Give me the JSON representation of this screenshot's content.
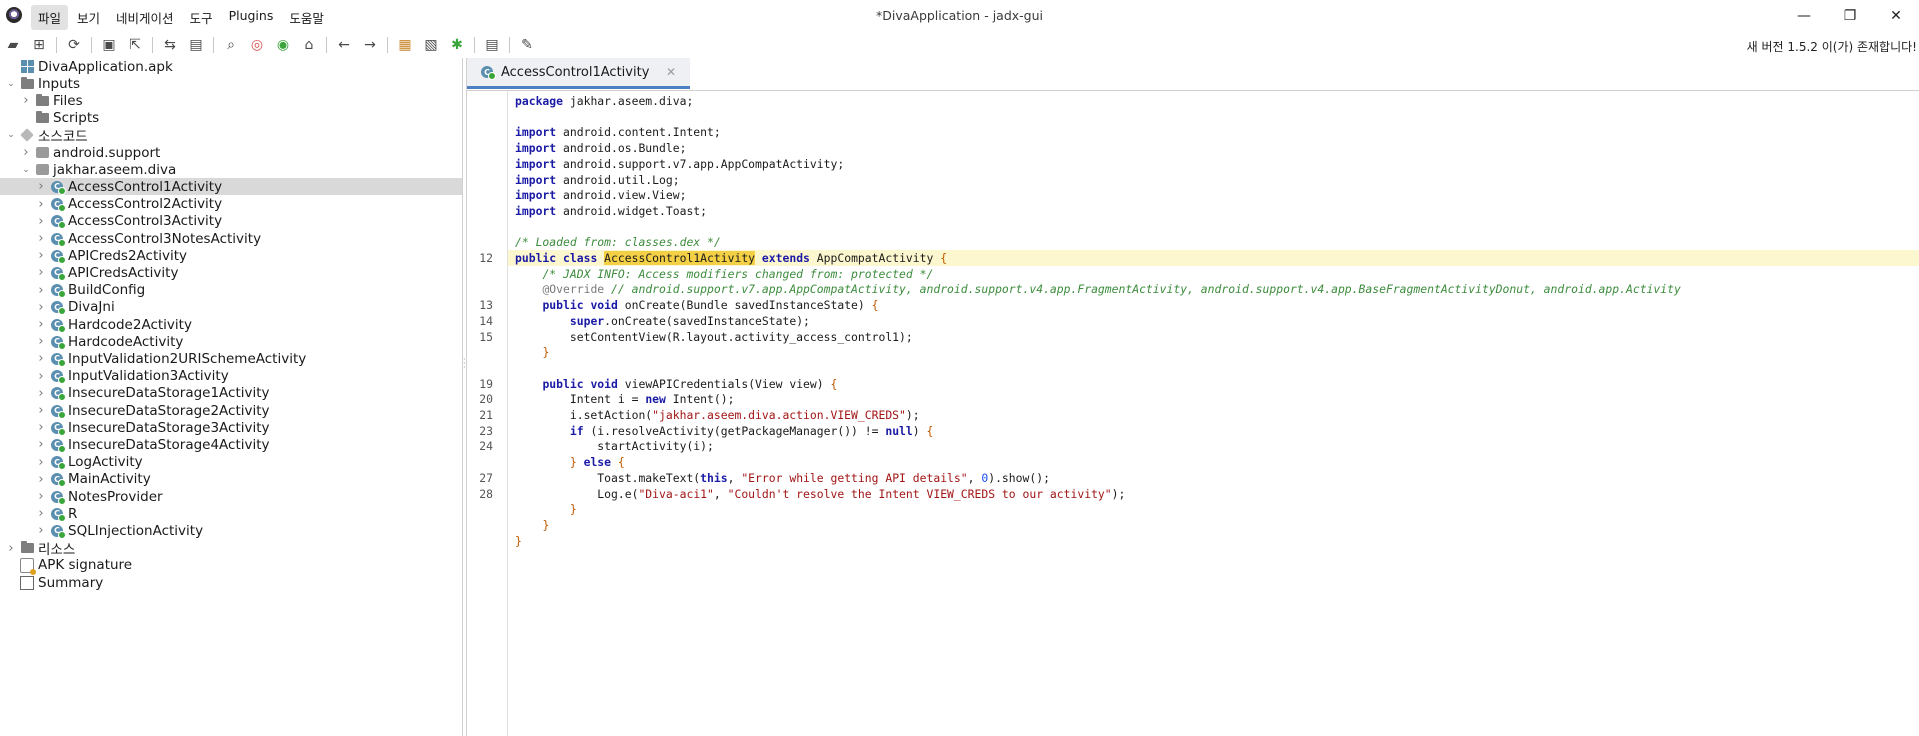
{
  "window": {
    "title": "*DivaApplication - jadx-gui",
    "minimize": "—",
    "maximize": "❐",
    "close": "✕"
  },
  "menu": [
    {
      "label": "파일",
      "active": true
    },
    {
      "label": "보기"
    },
    {
      "label": "네비게이션"
    },
    {
      "label": "도구"
    },
    {
      "label": "Plugins"
    },
    {
      "label": "도움말"
    }
  ],
  "toolbar": {
    "groups": [
      [
        "open-file-icon",
        "add-files-icon"
      ],
      [
        "sync-icon"
      ],
      [
        "save-icon",
        "export-icon"
      ],
      [
        "sync-with-editor-icon",
        "flatten-packages-icon"
      ],
      [
        "search-icon",
        "find-usage-icon",
        "goto-icon",
        "home-icon"
      ],
      [
        "back-icon",
        "forward-icon"
      ],
      [
        "deobfuscation-icon",
        "quark-icon",
        "debug-icon"
      ],
      [
        "log-icon"
      ],
      [
        "preferences-icon"
      ]
    ]
  },
  "update_notice": "새 버전 1.5.2 이(가) 존재합니다!",
  "tree": [
    {
      "label": "DivaApplication.apk",
      "icon": "apk-icon",
      "level": 0,
      "caret": ""
    },
    {
      "label": "Inputs",
      "icon": "folder-icon",
      "level": 0,
      "caret": "down"
    },
    {
      "label": "Files",
      "icon": "folder-icon",
      "level": 1,
      "caret": "right"
    },
    {
      "label": "Scripts",
      "icon": "folder-icon",
      "level": 1,
      "caret": ""
    },
    {
      "label": "소스코드",
      "icon": "source-icon",
      "level": 0,
      "caret": "down"
    },
    {
      "label": "android.support",
      "icon": "package-icon",
      "level": 1,
      "caret": "right"
    },
    {
      "label": "jakhar.aseem.diva",
      "icon": "package-icon",
      "level": 1,
      "caret": "down"
    },
    {
      "label": "AccessControl1Activity",
      "icon": "class-icon",
      "level": 2,
      "caret": "right",
      "selected": true
    },
    {
      "label": "AccessControl2Activity",
      "icon": "class-icon",
      "level": 2,
      "caret": "right"
    },
    {
      "label": "AccessControl3Activity",
      "icon": "class-icon",
      "level": 2,
      "caret": "right"
    },
    {
      "label": "AccessControl3NotesActivity",
      "icon": "class-icon",
      "level": 2,
      "caret": "right"
    },
    {
      "label": "APICreds2Activity",
      "icon": "class-icon",
      "level": 2,
      "caret": "right"
    },
    {
      "label": "APICredsActivity",
      "icon": "class-icon",
      "level": 2,
      "caret": "right"
    },
    {
      "label": "BuildConfig",
      "icon": "class-icon",
      "level": 2,
      "caret": "right"
    },
    {
      "label": "DivaJni",
      "icon": "class-icon",
      "level": 2,
      "caret": "right"
    },
    {
      "label": "Hardcode2Activity",
      "icon": "class-icon",
      "level": 2,
      "caret": "right"
    },
    {
      "label": "HardcodeActivity",
      "icon": "class-icon",
      "level": 2,
      "caret": "right"
    },
    {
      "label": "InputValidation2URISchemeActivity",
      "icon": "class-icon",
      "level": 2,
      "caret": "right"
    },
    {
      "label": "InputValidation3Activity",
      "icon": "class-icon",
      "level": 2,
      "caret": "right"
    },
    {
      "label": "InsecureDataStorage1Activity",
      "icon": "class-icon",
      "level": 2,
      "caret": "right"
    },
    {
      "label": "InsecureDataStorage2Activity",
      "icon": "class-icon",
      "level": 2,
      "caret": "right"
    },
    {
      "label": "InsecureDataStorage3Activity",
      "icon": "class-icon",
      "level": 2,
      "caret": "right"
    },
    {
      "label": "InsecureDataStorage4Activity",
      "icon": "class-icon",
      "level": 2,
      "caret": "right"
    },
    {
      "label": "LogActivity",
      "icon": "class-icon",
      "level": 2,
      "caret": "right"
    },
    {
      "label": "MainActivity",
      "icon": "class-icon",
      "level": 2,
      "caret": "right"
    },
    {
      "label": "NotesProvider",
      "icon": "class-icon",
      "level": 2,
      "caret": "right"
    },
    {
      "label": "R",
      "icon": "class-icon",
      "level": 2,
      "caret": "right"
    },
    {
      "label": "SQLInjectionActivity",
      "icon": "class-icon",
      "level": 2,
      "caret": "right"
    },
    {
      "label": "리소스",
      "icon": "folder-icon",
      "level": 0,
      "caret": "right"
    },
    {
      "label": "APK signature",
      "icon": "signature-icon",
      "level": 0,
      "caret": ""
    },
    {
      "label": "Summary",
      "icon": "summary-icon",
      "level": 0,
      "caret": ""
    }
  ],
  "editor": {
    "tab_label": "AccessControl1Activity",
    "tab_close": "✕",
    "lines": [
      {
        "no": "",
        "tokens": [
          [
            "kw",
            "package"
          ],
          [
            "plain",
            " jakhar.aseem.diva;"
          ]
        ]
      },
      {
        "no": "",
        "tokens": []
      },
      {
        "no": "",
        "tokens": [
          [
            "kw",
            "import"
          ],
          [
            "plain",
            " android.content.Intent;"
          ]
        ]
      },
      {
        "no": "",
        "tokens": [
          [
            "kw",
            "import"
          ],
          [
            "plain",
            " android.os.Bundle;"
          ]
        ]
      },
      {
        "no": "",
        "tokens": [
          [
            "kw",
            "import"
          ],
          [
            "plain",
            " android.support.v7.app.AppCompatActivity;"
          ]
        ]
      },
      {
        "no": "",
        "tokens": [
          [
            "kw",
            "import"
          ],
          [
            "plain",
            " android.util.Log;"
          ]
        ]
      },
      {
        "no": "",
        "tokens": [
          [
            "kw",
            "import"
          ],
          [
            "plain",
            " android.view.View;"
          ]
        ]
      },
      {
        "no": "",
        "tokens": [
          [
            "kw",
            "import"
          ],
          [
            "plain",
            " android.widget.Toast;"
          ]
        ]
      },
      {
        "no": "",
        "tokens": []
      },
      {
        "no": "",
        "tokens": [
          [
            "cmt",
            "/* Loaded from: classes.dex */"
          ]
        ]
      },
      {
        "no": "12",
        "highlight": true,
        "tokens": [
          [
            "kw",
            "public"
          ],
          [
            "plain",
            " "
          ],
          [
            "kw",
            "class"
          ],
          [
            "plain",
            " "
          ],
          [
            "cursor",
            ""
          ],
          [
            "hlword",
            "AccessControl1Activity"
          ],
          [
            "plain",
            " "
          ],
          [
            "kw",
            "extends"
          ],
          [
            "plain",
            " AppCompatActivity "
          ],
          [
            "brace",
            "{"
          ]
        ]
      },
      {
        "no": "",
        "tokens": [
          [
            "plain",
            "    "
          ],
          [
            "cmt",
            "/* JADX INFO: Access modifiers changed from: protected */"
          ]
        ]
      },
      {
        "no": "",
        "tokens": [
          [
            "plain",
            "    "
          ],
          [
            "ann",
            "@Override"
          ],
          [
            "plain",
            " "
          ],
          [
            "cmt",
            "// android.support.v7.app.AppCompatActivity, android.support.v4.app.FragmentActivity, android.support.v4.app.BaseFragmentActivityDonut, android.app.Activity"
          ]
        ]
      },
      {
        "no": "13",
        "tokens": [
          [
            "plain",
            "    "
          ],
          [
            "kw",
            "public"
          ],
          [
            "plain",
            " "
          ],
          [
            "kw",
            "void"
          ],
          [
            "plain",
            " onCreate(Bundle savedInstanceState) "
          ],
          [
            "brace",
            "{"
          ]
        ]
      },
      {
        "no": "14",
        "tokens": [
          [
            "plain",
            "        "
          ],
          [
            "kw",
            "super"
          ],
          [
            "plain",
            ".onCreate(savedInstanceState);"
          ]
        ]
      },
      {
        "no": "15",
        "tokens": [
          [
            "plain",
            "        setContentView(R.layout.activity_access_control1);"
          ]
        ]
      },
      {
        "no": "",
        "tokens": [
          [
            "plain",
            "    "
          ],
          [
            "brace",
            "}"
          ]
        ]
      },
      {
        "no": "",
        "tokens": []
      },
      {
        "no": "19",
        "tokens": [
          [
            "plain",
            "    "
          ],
          [
            "kw",
            "public"
          ],
          [
            "plain",
            " "
          ],
          [
            "kw",
            "void"
          ],
          [
            "plain",
            " viewAPICredentials(View view) "
          ],
          [
            "brace",
            "{"
          ]
        ]
      },
      {
        "no": "20",
        "tokens": [
          [
            "plain",
            "        Intent i = "
          ],
          [
            "kw",
            "new"
          ],
          [
            "plain",
            " Intent();"
          ]
        ]
      },
      {
        "no": "21",
        "tokens": [
          [
            "plain",
            "        i.setAction("
          ],
          [
            "str",
            "\"jakhar.aseem.diva.action.VIEW_CREDS\""
          ],
          [
            "plain",
            ");"
          ]
        ]
      },
      {
        "no": "23",
        "tokens": [
          [
            "plain",
            "        "
          ],
          [
            "kw",
            "if"
          ],
          [
            "plain",
            " (i.resolveActivity(getPackageManager()) != "
          ],
          [
            "kw",
            "null"
          ],
          [
            "plain",
            ") "
          ],
          [
            "brace",
            "{"
          ]
        ]
      },
      {
        "no": "24",
        "tokens": [
          [
            "plain",
            "            startActivity(i);"
          ]
        ]
      },
      {
        "no": "",
        "tokens": [
          [
            "plain",
            "        "
          ],
          [
            "brace",
            "}"
          ],
          [
            "plain",
            " "
          ],
          [
            "kw",
            "else"
          ],
          [
            "plain",
            " "
          ],
          [
            "brace",
            "{"
          ]
        ]
      },
      {
        "no": "27",
        "tokens": [
          [
            "plain",
            "            Toast.makeText("
          ],
          [
            "kw",
            "this"
          ],
          [
            "plain",
            ", "
          ],
          [
            "str",
            "\"Error while getting API details\""
          ],
          [
            "plain",
            ", "
          ],
          [
            "num",
            "0"
          ],
          [
            "plain",
            ").show();"
          ]
        ]
      },
      {
        "no": "28",
        "tokens": [
          [
            "plain",
            "            Log.e("
          ],
          [
            "str",
            "\"Diva-aci1\""
          ],
          [
            "plain",
            ", "
          ],
          [
            "str",
            "\"Couldn't resolve the Intent VIEW_CREDS to our activity\""
          ],
          [
            "plain",
            ");"
          ]
        ]
      },
      {
        "no": "",
        "tokens": [
          [
            "plain",
            "        "
          ],
          [
            "brace",
            "}"
          ]
        ]
      },
      {
        "no": "",
        "tokens": [
          [
            "plain",
            "    "
          ],
          [
            "brace",
            "}"
          ]
        ]
      },
      {
        "no": "",
        "tokens": [
          [
            "brace",
            "}"
          ]
        ]
      }
    ]
  }
}
